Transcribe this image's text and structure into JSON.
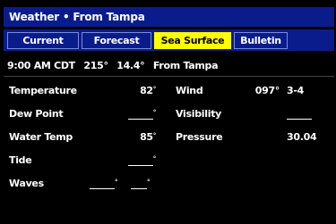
{
  "window": {
    "title": "Weather • From Tampa"
  },
  "tabs": [
    {
      "label": "Current"
    },
    {
      "label": "Forecast"
    },
    {
      "label": "Sea Surface"
    },
    {
      "label": "Bulletin"
    }
  ],
  "station": {
    "time": "9:00 AM CDT",
    "bearing": "215°",
    "distance": "14.4°",
    "from": "From Tampa"
  },
  "rows": [
    {
      "left_label": "Temperature",
      "left_value": "82",
      "right_label": "Wind",
      "right_value": "097°",
      "right_value2": "3-4"
    },
    {
      "left_label": "Dew Point",
      "left_value": "",
      "right_label": "Visibility",
      "right_value": "",
      "right_value2": ""
    },
    {
      "left_label": "Water Temp",
      "left_value": "85",
      "right_label": "Pressure",
      "right_value": "",
      "right_value2": "30.04"
    },
    {
      "left_label": "Tide",
      "left_value": "",
      "right_label": "",
      "right_value": "",
      "right_value2": ""
    },
    {
      "left_label": "Waves",
      "left_value": "",
      "right_label": "",
      "right_value": "",
      "right_value2": ""
    }
  ],
  "colors": {
    "title_bg": "#0a1c8c",
    "active_tab": "#ffff00"
  }
}
